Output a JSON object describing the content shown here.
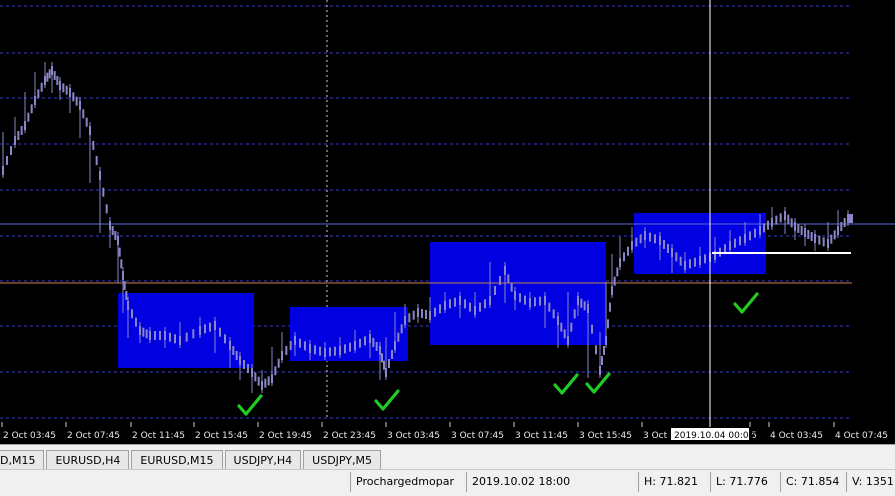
{
  "chart": {
    "time_labels": [
      "2 Oct 03:45",
      "2 Oct 07:45",
      "2 Oct 11:45",
      "2 Oct 15:45",
      "2 Oct 19:45",
      "2 Oct 23:45",
      "3 Oct 03:45",
      "3 Oct 07:45",
      "3 Oct 11:45",
      "3 Oct 15:45",
      "3 Oct 1",
      "5",
      "4 Oct 03:45",
      "4 Oct 07:45"
    ],
    "crosshair_time_label": "2019.10.04 00:00",
    "colors": {
      "background": "#000000",
      "candles": "#8a86c8",
      "grid": "#3a3ad0",
      "zone": "#0000e0",
      "horizontal_line_blue": "#5a6ad8",
      "horizontal_line_orange": "#c8824a",
      "white_line": "#ffffff",
      "checkmark": "#22cc22",
      "crosshair": "#ffffff"
    },
    "checkmark_icon": "check-icon"
  },
  "tabs": [
    {
      "label": "D,M15"
    },
    {
      "label": "EURUSD,H4"
    },
    {
      "label": "EURUSD,M15"
    },
    {
      "label": "USDJPY,H4"
    },
    {
      "label": "USDJPY,M5"
    }
  ],
  "status": {
    "profile": "Prochargedmopar",
    "datetime": "2019.10.02 18:00",
    "high": "H: 71.821",
    "low": "L: 71.776",
    "close": "C: 71.854",
    "volume": "V: 1351"
  }
}
